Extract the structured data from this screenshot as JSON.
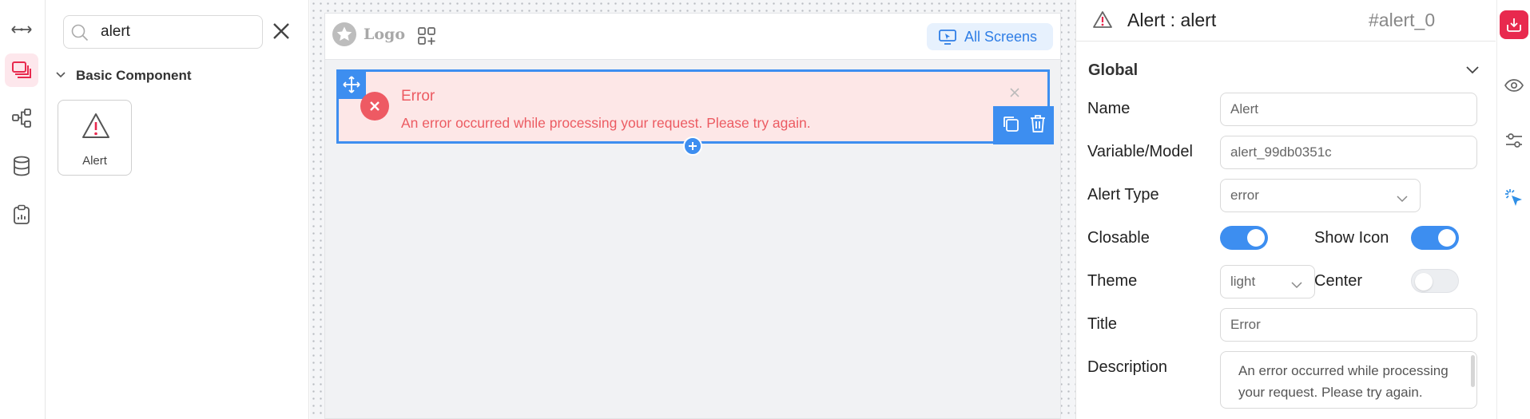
{
  "search": {
    "value": "alert",
    "placeholder": "Search"
  },
  "components": {
    "group_label": "Basic Component",
    "items": [
      {
        "label": "Alert",
        "icon": "alert-triangle-icon"
      }
    ]
  },
  "canvas": {
    "logo_text": "Logo",
    "all_screens_label": "All Screens",
    "alert": {
      "title": "Error",
      "description": "An error occurred while processing your request. Please try again."
    }
  },
  "properties": {
    "header_title": "Alert : alert",
    "component_id": "#alert_0",
    "section_label": "Global",
    "fields": {
      "name": {
        "label": "Name",
        "value": "Alert"
      },
      "variable": {
        "label": "Variable/Model",
        "value": "alert_99db0351c"
      },
      "alert_type": {
        "label": "Alert Type",
        "value": "error"
      },
      "closable": {
        "label": "Closable",
        "on": true
      },
      "show_icon": {
        "label": "Show Icon",
        "on": true
      },
      "theme": {
        "label": "Theme",
        "value": "light"
      },
      "center": {
        "label": "Center",
        "on": false
      },
      "title": {
        "label": "Title",
        "value": "Error"
      },
      "description": {
        "label": "Description",
        "value": "An error occurred while processing your request. Please try again."
      }
    }
  },
  "colors": {
    "accent": "#3d8ef0",
    "brand": "#e8294e",
    "error": "#ec5b62",
    "error_bg": "#fde7e7"
  }
}
